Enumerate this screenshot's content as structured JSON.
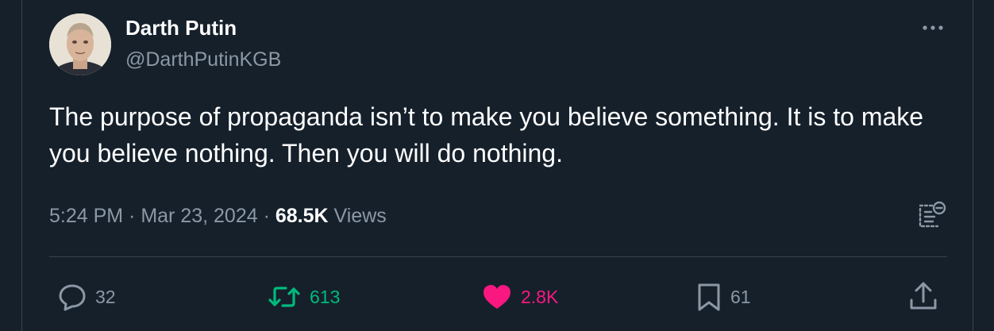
{
  "user": {
    "name": "Darth Putin",
    "handle": "@DarthPutinKGB"
  },
  "tweet": {
    "text": "The purpose of propaganda isn’t to make you believe something. It is to make you believe nothing. Then you will do nothing."
  },
  "meta": {
    "time": "5:24 PM",
    "sep1": " · ",
    "date": "Mar 23, 2024",
    "sep2": " · ",
    "views_count": "68.5K",
    "views_label": " Views"
  },
  "actions": {
    "replies": "32",
    "retweets": "613",
    "likes": "2.8K",
    "bookmarks": "61"
  },
  "colors": {
    "background": "#15202b",
    "secondary_text": "#8b98a5",
    "retweet": "#00ba7c",
    "like": "#f91880",
    "divider": "#38444d"
  },
  "icons": [
    "more-icon",
    "summary-icon",
    "reply-icon",
    "retweet-icon",
    "heart-icon",
    "bookmark-icon",
    "share-icon"
  ]
}
